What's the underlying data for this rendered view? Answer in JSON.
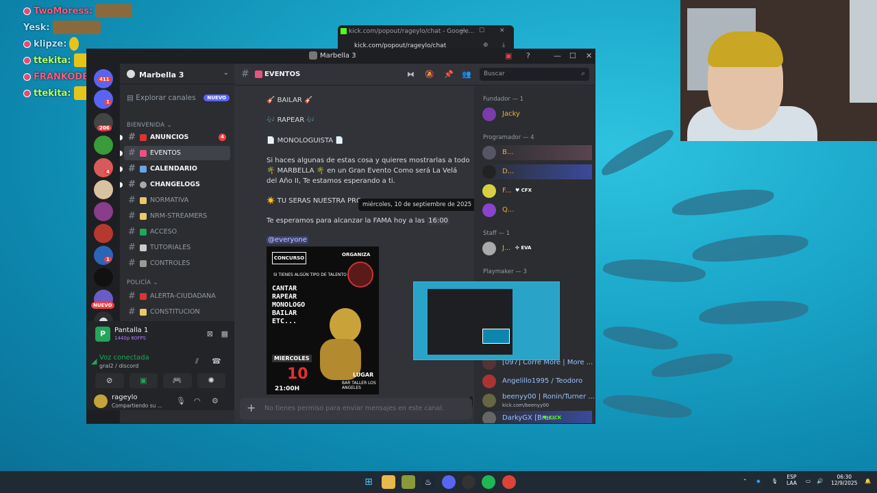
{
  "stream_chat": [
    {
      "name": "TwoMoress:",
      "style": "a"
    },
    {
      "name": "Yesk:",
      "style": "b"
    },
    {
      "name": "klipze:",
      "style": "b"
    },
    {
      "name": "ttekita:",
      "style": "c"
    },
    {
      "name": "FRANKODEARMAS:",
      "style": "a"
    },
    {
      "name": "ttekita:",
      "style": "c"
    }
  ],
  "kick": {
    "title": "kick.com/popout/rageylo/chat - Google...",
    "url": "kick.com/popout/rageylo/chat"
  },
  "window": {
    "title": "Marbella 3"
  },
  "guild_badges": [
    "411",
    "1",
    "206",
    "4",
    "1",
    "NUEVO"
  ],
  "server": {
    "name": "Marbella 3"
  },
  "explore": {
    "label": "Explorar canales",
    "badge": "NUEVO"
  },
  "categories": {
    "bienvenida": "BIENVENIDA",
    "policia": "POLICÍA"
  },
  "channels": [
    {
      "name": "ANUNCIOS",
      "badge": "4"
    },
    {
      "name": "EVENTOS"
    },
    {
      "name": "CALENDARIO"
    },
    {
      "name": "CHANGELOGS"
    },
    {
      "name": "NORMATIVA"
    },
    {
      "name": "NRM-STREAMERS"
    },
    {
      "name": "ACCESO"
    },
    {
      "name": "TUTORIALES"
    },
    {
      "name": "CONTROLES"
    },
    {
      "name": "ALERTA-CIUDADANA"
    },
    {
      "name": "CONSTITUCION"
    }
  ],
  "stream_panel": {
    "title": "Pantalla 1",
    "sub": "1440p 60FPS"
  },
  "voice": {
    "status": "Voz conectada",
    "channel": "gral2 / discord"
  },
  "user": {
    "name": "rageylo",
    "status": "Compartiendo su ..."
  },
  "header": {
    "channel": "EVENTOS",
    "search_placeholder": "Buscar"
  },
  "message": {
    "l1": "BAILAR",
    "l2": "RAPEAR",
    "l3": "MONOLOGUISTA",
    "p1": "Si haces algunas de estas cosa y quieres mostrarlas a todo",
    "p1b": "MARBELLA",
    "p1c": "en un Gran Evento Como será La Velá",
    "p1d": "del Año II, Te estamos esperando a ti.",
    "p2": "TU SERAS NUESTRA PRO",
    "p3": "Te esperamos para alcanzar la FAMA  hoy a las",
    "time": "16:00",
    "tooltip": "miércoles, 10 de septiembre de 2025 16:00",
    "mention": "@everyone"
  },
  "poster": {
    "top": "CONCURSO",
    "org": "ORGANIZA",
    "talent": "SI TIENES ALGÚN TIPO DE TALENTO",
    "acts": "CANTAR\nRAPEAR\nMONOLOGO\nBAILAR\nETC...",
    "day": "MIERCOLES",
    "num": "10",
    "hour": "21:00H",
    "place": "LUGAR",
    "place2": "BAR TALLER LOS ANGELES"
  },
  "input_placeholder": "No tienes permiso para enviar mensajes en este canal.",
  "member_groups": {
    "fundador": "Fundador — 1",
    "programador": "Programador — 4",
    "staff": "Staff — 1",
    "playmaker": "Playmaker — 3"
  },
  "members": [
    {
      "name": "Jacky",
      "color": "#f0b232"
    },
    {
      "name": "B...",
      "color": "#f0b232"
    },
    {
      "name": "D...",
      "color": "#f0b232"
    },
    {
      "name": "F...",
      "color": "#f0b232",
      "tag": "CFX"
    },
    {
      "name": "Q...",
      "color": "#f0b232"
    },
    {
      "name": "J...",
      "color": "#f0b232",
      "tag": "EVA"
    },
    {
      "name": "[097] Corre More | More ...",
      "color": "#9cc1ff"
    },
    {
      "name": "Angelillo1995 / Teodoro",
      "color": "#9cc1ff"
    },
    {
      "name": "beenyy00 | Ronin/Turner ...",
      "color": "#9cc1ff",
      "sub": "kick.com/beenyy00"
    },
    {
      "name": "DarkyGX [Bra...",
      "color": "#9cc1ff",
      "tag": "KICK"
    }
  ],
  "tray": {
    "lang": "ESP",
    "lang2": "LAA",
    "time": "06:30",
    "date": "12/9/2025"
  }
}
